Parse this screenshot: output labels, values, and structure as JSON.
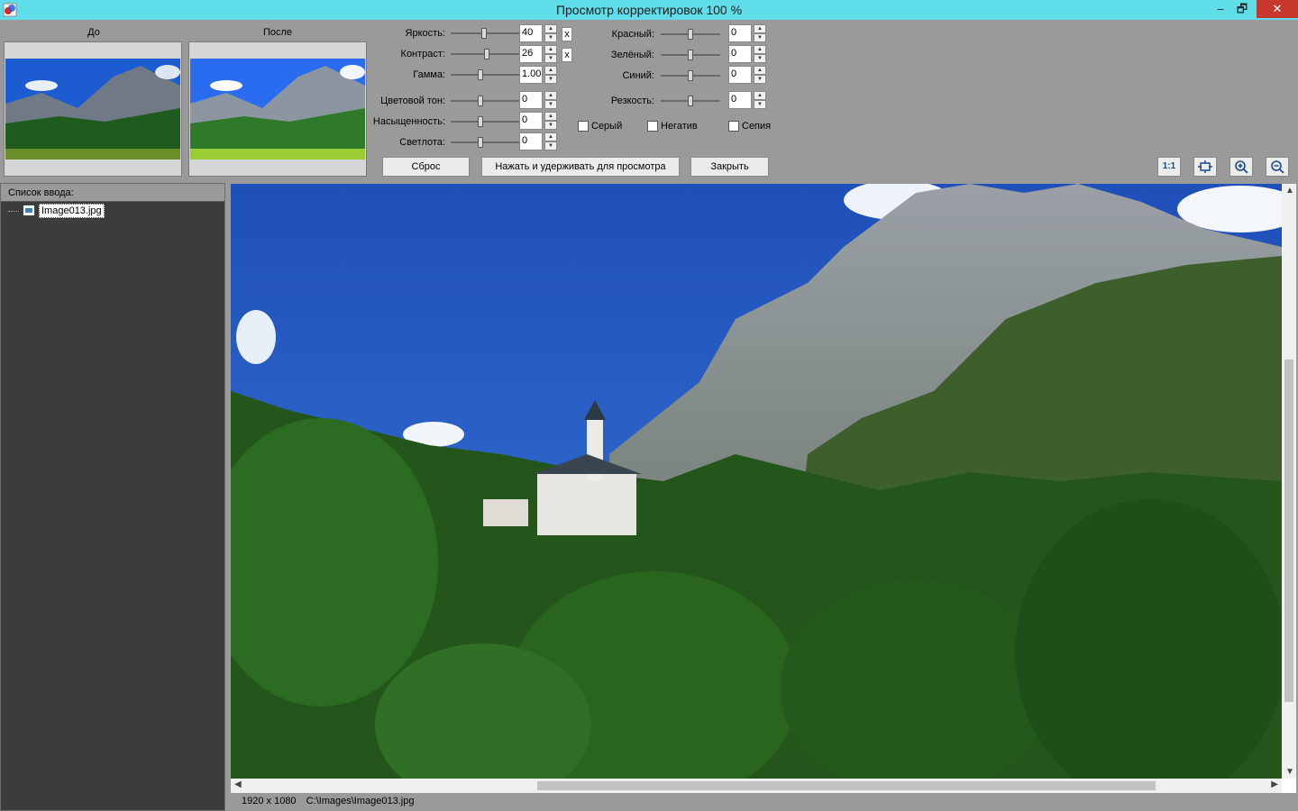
{
  "window": {
    "title": "Просмотр корректировок 100 %",
    "minimize": "–",
    "restore": "🗗",
    "close": "✕"
  },
  "previews": {
    "before_label": "До",
    "after_label": "После"
  },
  "adjust": {
    "brightness": {
      "label": "Яркость:",
      "value": "40"
    },
    "contrast": {
      "label": "Контраст:",
      "value": "26"
    },
    "gamma": {
      "label": "Гамма:",
      "value": "1.00"
    },
    "hue": {
      "label": "Цветовой тон:",
      "value": "0"
    },
    "saturation": {
      "label": "Насыщенность:",
      "value": "0"
    },
    "lightness": {
      "label": "Светлота:",
      "value": "0"
    },
    "red": {
      "label": "Красный:",
      "value": "0"
    },
    "green": {
      "label": "Зелёный:",
      "value": "0"
    },
    "blue": {
      "label": "Синий:",
      "value": "0"
    },
    "sharpness": {
      "label": "Резкость:",
      "value": "0"
    },
    "reset_x": "x"
  },
  "checkboxes": {
    "gray": "Серый",
    "negative": "Негатив",
    "sepia": "Сепия"
  },
  "buttons": {
    "reset": "Сброс",
    "hold_preview": "Нажать и удерживать для просмотра",
    "close": "Закрыть"
  },
  "tools": {
    "one_to_one": "1:1"
  },
  "input_list": {
    "header": "Список ввода:",
    "items": [
      "Image013.jpg"
    ]
  },
  "status": {
    "dimensions": "1920 x 1080",
    "path": "C:\\Images\\Image013.jpg"
  },
  "colors": {
    "titlebar": "#5fdde8",
    "close": "#c7382c",
    "panel": "#9a9a9a",
    "list_bg": "#3c3c3c"
  }
}
